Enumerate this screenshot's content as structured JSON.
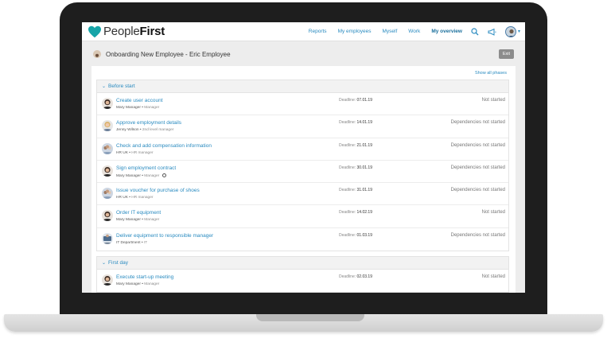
{
  "app": {
    "brand_first": "People",
    "brand_second": "First",
    "nav": [
      {
        "label": "Reports",
        "active": false
      },
      {
        "label": "My employees",
        "active": false
      },
      {
        "label": "Myself",
        "active": false
      },
      {
        "label": "Work",
        "active": false
      },
      {
        "label": "My overview",
        "active": true
      }
    ],
    "accent_color": "#2a8bc0",
    "logo_color": "#16a4a8"
  },
  "page": {
    "title": "Onboarding New Employee - Eric Employee",
    "exit_label": "Exit",
    "show_all_label": "Show all phases"
  },
  "phases": [
    {
      "label": "Before start",
      "tasks": [
        {
          "name": "Create user account",
          "person": "Mary Manager",
          "role": "Manager",
          "deadline_label": "Deadline:",
          "deadline": "07.01.19",
          "status": "Not started",
          "avatar": "woman-dark"
        },
        {
          "name": "Approve employment details",
          "person": "Jenny Wilson",
          "role": "2nd level manager",
          "deadline_label": "Deadline:",
          "deadline": "14.01.19",
          "status": "Dependencies not started",
          "avatar": "woman-blonde"
        },
        {
          "name": "Check and add compensation information",
          "person": "HR UK",
          "role": "HR manager",
          "deadline_label": "Deadline:",
          "deadline": "21.01.19",
          "status": "Dependencies not started",
          "avatar": "group"
        },
        {
          "name": "Sign employment contract",
          "person": "Mary Manager",
          "role": "Manager",
          "deadline_label": "Deadline:",
          "deadline": "30.01.19",
          "status": "Dependencies not started",
          "avatar": "woman-dark",
          "info_icon": true
        },
        {
          "name": "Issue voucher for purchase of shoes",
          "person": "HR UK",
          "role": "HR manager",
          "deadline_label": "Deadline:",
          "deadline": "31.01.19",
          "status": "Dependencies not started",
          "avatar": "group"
        },
        {
          "name": "Order IT equipment",
          "person": "Mary Manager",
          "role": "Manager",
          "deadline_label": "Deadline:",
          "deadline": "14.02.19",
          "status": "Not started",
          "avatar": "woman-dark"
        },
        {
          "name": "Deliver equipment to responsible manager",
          "person": "IT Department",
          "role": "IT",
          "deadline_label": "Deadline:",
          "deadline": "01.03.19",
          "status": "Dependencies not started",
          "avatar": "group-it"
        }
      ]
    },
    {
      "label": "First day",
      "tasks": [
        {
          "name": "Execute start-up meeting",
          "person": "Mary Manager",
          "role": "Manager",
          "deadline_label": "Deadline:",
          "deadline": "02.03.19",
          "status": "Not started",
          "avatar": "woman-dark"
        }
      ]
    }
  ]
}
